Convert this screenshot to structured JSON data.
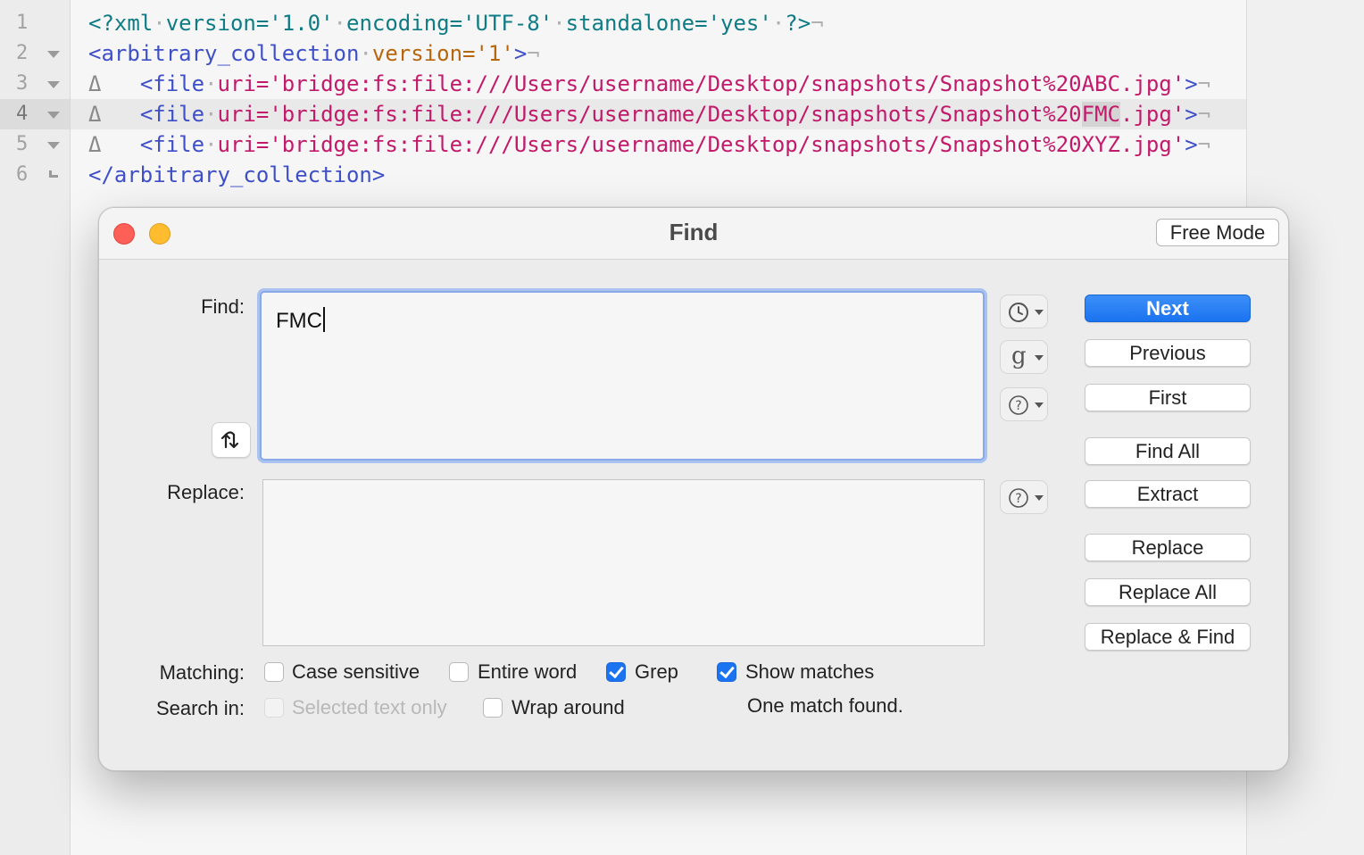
{
  "editor": {
    "line_numbers": [
      "1",
      "2",
      "3",
      "4",
      "5",
      "6"
    ],
    "current_line": "4",
    "lines": [
      {
        "parts": [
          "<?xml",
          "·",
          "version='1.0'",
          "·",
          "encoding='UTF-8'",
          "·",
          "standalone='yes'",
          "·",
          "?>",
          "¬"
        ]
      },
      {
        "parts": [
          "<arbitrary_collection",
          "·",
          "version='1'",
          ">",
          "¬"
        ]
      },
      {
        "delta": "Δ",
        "parts": [
          "<file",
          "·",
          "uri='bridge:fs:file:///Users/username/Desktop/snapshots/Snapshot%20ABC.jpg'",
          ">",
          "¬"
        ]
      },
      {
        "delta": "Δ",
        "parts": [
          "<file",
          "·",
          "uri='bridge:fs:file:///Users/username/Desktop/snapshots/Snapshot%20",
          "FMC",
          ".jpg'",
          ">",
          "¬"
        ]
      },
      {
        "delta": "Δ",
        "parts": [
          "<file",
          "·",
          "uri='bridge:fs:file:///Users/username/Desktop/snapshots/Snapshot%20XYZ.jpg'",
          ">",
          "¬"
        ]
      },
      {
        "parts": [
          "</arbitrary_collection>"
        ]
      }
    ]
  },
  "dialog": {
    "title": "Find",
    "free_mode_label": "Free Mode",
    "find_label": "Find:",
    "find_value": "FMC",
    "replace_label": "Replace:",
    "replace_value": "",
    "side_icons": [
      "history-icon",
      "grep-pattern-icon",
      "help-icon",
      "help-icon"
    ],
    "g_glyph": "g",
    "buttons": {
      "next": "Next",
      "previous": "Previous",
      "first": "First",
      "find_all": "Find All",
      "extract": "Extract",
      "replace": "Replace",
      "replace_all": "Replace All",
      "replace_find": "Replace & Find"
    },
    "matching_label": "Matching:",
    "search_in_label": "Search in:",
    "options": {
      "case_sensitive": {
        "label": "Case sensitive",
        "checked": false
      },
      "entire_word": {
        "label": "Entire word",
        "checked": false
      },
      "grep": {
        "label": "Grep",
        "checked": true
      },
      "show_matches": {
        "label": "Show matches",
        "checked": true
      },
      "selected_text_only": {
        "label": "Selected text only",
        "checked": false,
        "disabled": true
      },
      "wrap_around": {
        "label": "Wrap around",
        "checked": false
      }
    },
    "status": "One match found.",
    "accent_color": "#1a73f0"
  }
}
